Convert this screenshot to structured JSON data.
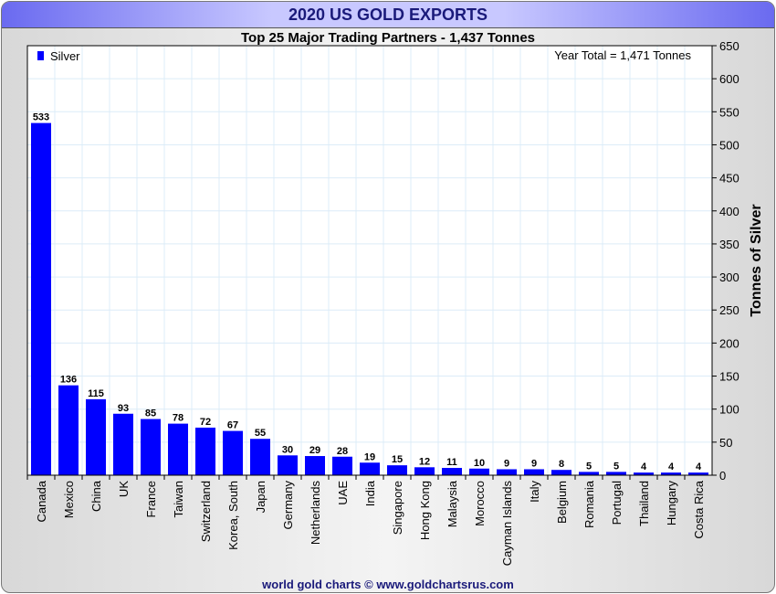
{
  "header": {
    "title": "2020 US GOLD EXPORTS",
    "subtitle": "Top 25 Major Trading Partners - 1,437 Tonnes",
    "footer": "world gold charts © www.goldchartsrus.com"
  },
  "chart_data": {
    "type": "bar",
    "title": "2020 US GOLD EXPORTS",
    "subtitle": "Top 25 Major Trading Partners - 1,437 Tonnes",
    "annotation": "Year Total = 1,471 Tonnes",
    "legend": [
      {
        "name": "Silver",
        "color": "#0000ff"
      }
    ],
    "legend_placement": "top-left",
    "ylabel": "Tonnes of Silver",
    "xlabel": "",
    "ylim": [
      0,
      650
    ],
    "yticks": [
      0,
      50,
      100,
      150,
      200,
      250,
      300,
      350,
      400,
      450,
      500,
      550,
      600,
      650
    ],
    "grid": true,
    "categories": [
      "Canada",
      "Mexico",
      "China",
      "UK",
      "France",
      "Taiwan",
      "Switzerland",
      "Korea, South",
      "Japan",
      "Germany",
      "Netherlands",
      "UAE",
      "India",
      "Singapore",
      "Hong Kong",
      "Malaysia",
      "Morocco",
      "Cayman Islands",
      "Italy",
      "Belgium",
      "Romania",
      "Portugal",
      "Thailand",
      "Hungary",
      "Costa Rica"
    ],
    "values": [
      533,
      136,
      115,
      93,
      85,
      78,
      72,
      67,
      55,
      30,
      29,
      28,
      19,
      15,
      12,
      11,
      10,
      9,
      9,
      8,
      5,
      5,
      4,
      4,
      4
    ],
    "bar_color": "#0000ff"
  }
}
